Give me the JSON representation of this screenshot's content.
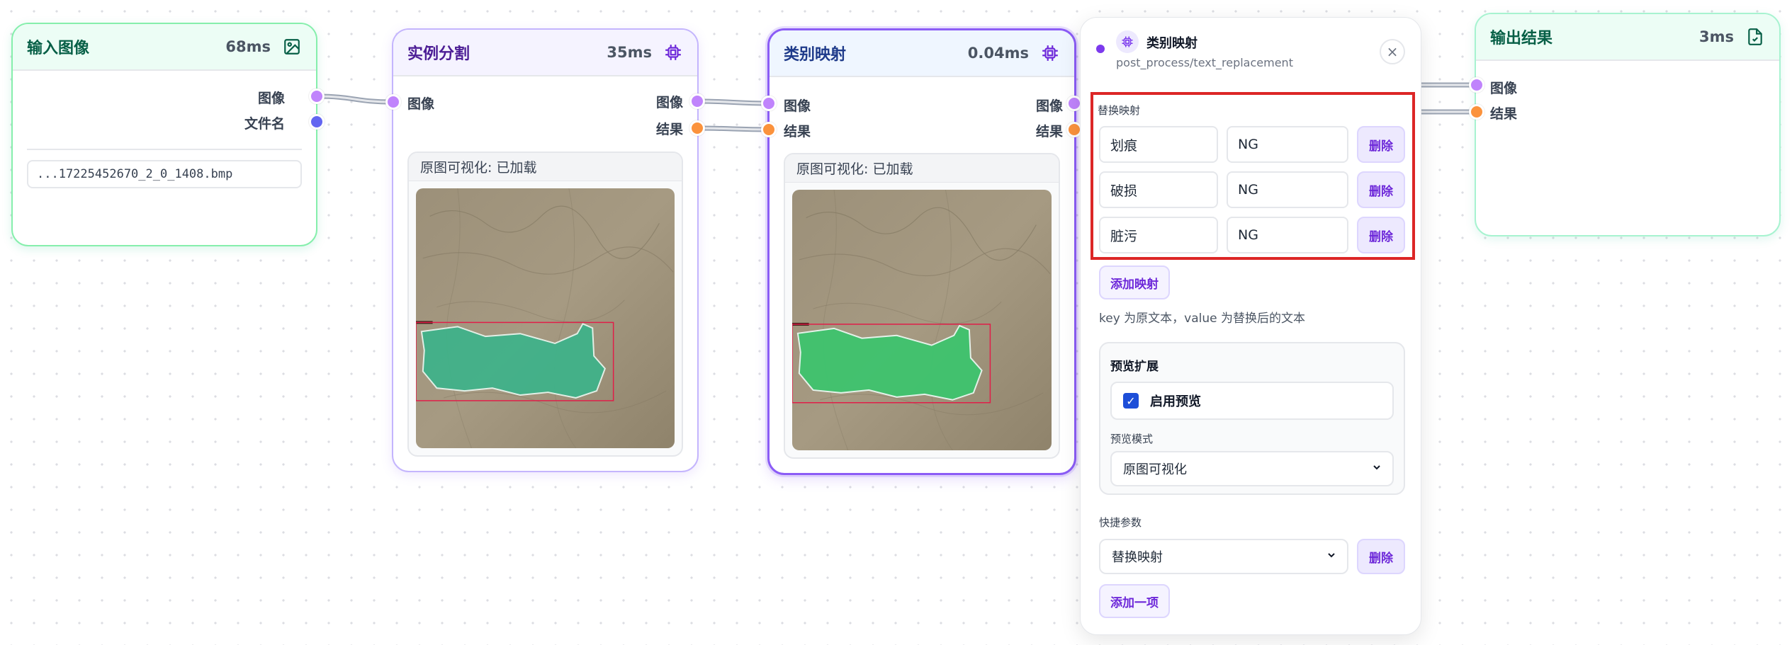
{
  "nodes": {
    "input": {
      "title": "输入图像",
      "time": "68ms",
      "icon": "image-icon",
      "ports_out": [
        "图像",
        "文件名"
      ],
      "filename": "...17225452670_2_0_1408.bmp"
    },
    "segmentation": {
      "title": "实例分割",
      "time": "35ms",
      "icon": "chip-icon",
      "ports_in": [
        "图像"
      ],
      "ports_out": [
        "图像",
        "结果"
      ],
      "preview_title": "原图可视化: 已加载"
    },
    "mapping": {
      "title": "类别映射",
      "time": "0.04ms",
      "icon": "chip-icon",
      "ports_in": [
        "图像",
        "结果"
      ],
      "ports_out": [
        "图像",
        "结果"
      ],
      "preview_title": "原图可视化: 已加载"
    },
    "output": {
      "title": "输出结果",
      "time": "3ms",
      "icon": "document-icon",
      "ports_in": [
        "图像",
        "结果"
      ]
    }
  },
  "panel": {
    "title": "类别映射",
    "subtitle": "post_process/text_replacement",
    "close_label": "×",
    "mapping_label": "替换映射",
    "mappings": [
      {
        "key": "划痕",
        "value": "NG",
        "delete": "删除"
      },
      {
        "key": "破损",
        "value": "NG",
        "delete": "删除"
      },
      {
        "key": "脏污",
        "value": "NG",
        "delete": "删除"
      }
    ],
    "add_mapping": "添加映射",
    "hint": "key 为原文本，value 为替换后的文本",
    "preview_ext": {
      "title": "预览扩展",
      "enable_label": "启用预览",
      "enable_checked": true,
      "mode_label": "预览模式",
      "mode_value": "原图可视化"
    },
    "quick": {
      "label": "快捷参数",
      "select_value": "替换映射",
      "delete": "删除",
      "add_item": "添加一项"
    }
  },
  "colors": {
    "accent": "#7c3aed",
    "port_image": "#c084fc",
    "port_result": "#fb923c",
    "port_filename": "#6366f1",
    "highlight": "#dc2626",
    "mask_seg": "#3db38a",
    "mask_map": "#3ec46e"
  }
}
